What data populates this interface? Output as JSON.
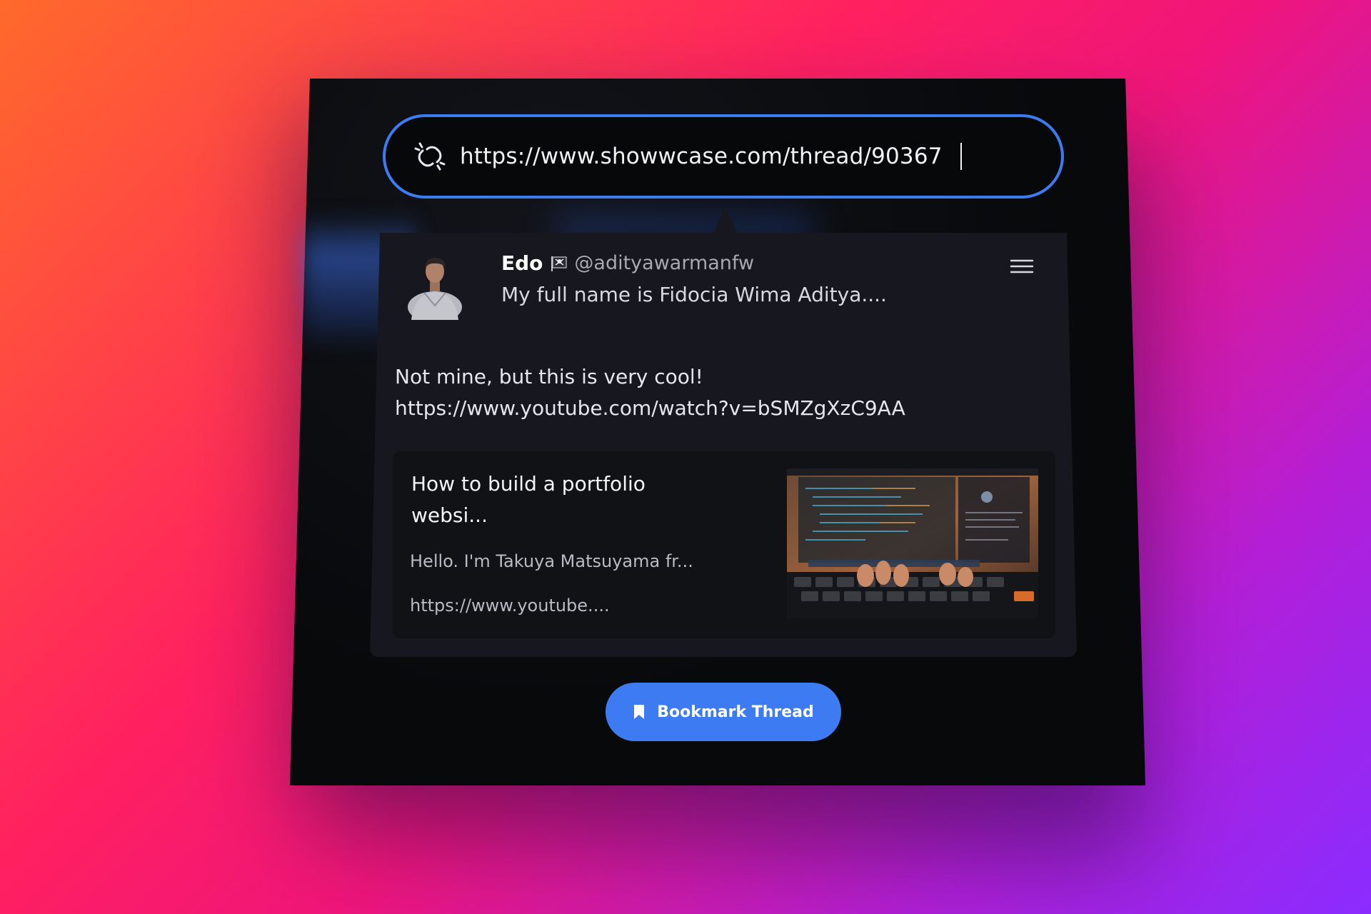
{
  "url_bar": {
    "value": "https://www.showwcase.com/thread/90367",
    "icon": "link-broken-icon"
  },
  "thread": {
    "author": {
      "name": "Edo",
      "badge_icon": "pirate-flag-icon",
      "handle": "@adityawarmanfw",
      "bio": "My full name is Fidocia Wima Aditya...."
    },
    "menu_icon": "hamburger-menu-icon",
    "body_text": "Not mine, but this is very cool!",
    "body_link": "https://www.youtube.com/watch?v=bSMZgXzC9AA",
    "link_preview": {
      "title": "How to build a portfolio websi...",
      "description": "Hello. I'm Takuya Matsuyama fr...",
      "url": "https://www.youtube...."
    }
  },
  "bookmark_button": {
    "label": "Bookmark Thread",
    "icon": "bookmark-icon"
  },
  "colors": {
    "accent": "#3d7bf2",
    "panel": "#08090b",
    "card": "#17181f"
  }
}
